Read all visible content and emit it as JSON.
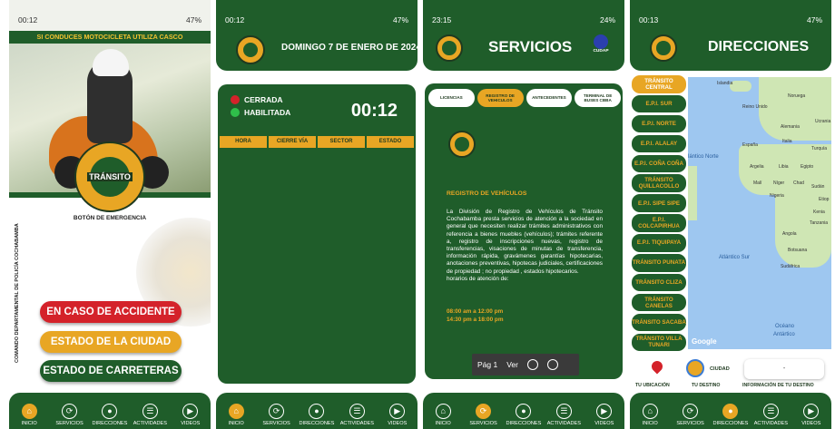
{
  "status": {
    "p1": {
      "time": "00:12",
      "battery": "47%"
    },
    "p2": {
      "time": "00:12",
      "battery": "47%"
    },
    "p3": {
      "time": "23:15",
      "battery": "24%"
    },
    "p4": {
      "time": "00:13",
      "battery": "47%"
    }
  },
  "nav": [
    "INICIO",
    "SERVICIOS",
    "DIRECCIONES",
    "ACTIVIDADES",
    "VIDEOS"
  ],
  "inicio": {
    "banner": "SI CONDUCES MOTOCICLETA UTILIZA CASCO",
    "logo_text": "TRÁNSITO",
    "emergency_label": "BOTÓN DE EMERGENCIA",
    "side_text": "COMANDO DEPARTAMENTAL DE POLICÍA COCHABAMBA",
    "buttons": [
      "EN CASO DE ACCIDENTE",
      "ESTADO DE LA CIUDAD",
      "ESTADO DE CARRETERAS"
    ]
  },
  "ciudad": {
    "date": "DOMINGO 7 DE ENERO DE 2024",
    "legend_closed": "CERRADA",
    "legend_open": "HABILITADA",
    "clock": "00:12",
    "columns": [
      "HORA",
      "CIERRE VÍA",
      "SECTOR",
      "ESTADO"
    ]
  },
  "servicios": {
    "title": "SERVICIOS",
    "cudap": "CUDAP",
    "tabs": [
      "LICENCIAS",
      "REGISTRO DE VEHICULOS",
      "ANTECEDENTES",
      "TERMINAL DE BUSES CBBA"
    ],
    "doc_title": "REGISTRO DE VEHÍCULOS",
    "doc_body": "La División de Registro de Vehículos de Tránsito Cochabamba presta servicios de atención a la sociedad en general que necesiten realizar trámites administrativos con referencia a bienes muebles (vehículos); trámites referente a, registro de inscripciones nuevas, registro de transferencias, visaciones de minutas de transferencia, información rápida, gravámenes garantías hipotecarias, anotaciones preventivas, hipotecas judiciales, certificaciones de propiedad ; no propiedad , estados hipotecarios.",
    "hours_label": "horarios de atención de:",
    "hours_1": "08:00 am a 12:00 pm",
    "hours_2": "14:30 pm a 18:00 pm",
    "pdf_page": "Pág 1",
    "pdf_view": "Ver"
  },
  "direcciones": {
    "title": "DIRECCIONES",
    "locations": [
      "TRÁNSITO CENTRAL",
      "E.P.I. SUR",
      "E.P.I. NORTE",
      "E.P.I. ALALAY",
      "E.P.I. COÑA COÑA",
      "TRÁNSITO QUILLACOLLO",
      "E.P.I. SIPE SIPE",
      "E.P.I. COLCAPIRHUA",
      "E.P.I. TIQUIPAYA",
      "TRÁNSITO PUNATA",
      "TRÁNSITO CLIZA",
      "TRÁNSITO CANELAS",
      "TRÁNSITO SACABA",
      "TRÁNSITO VILLA TUNARI"
    ],
    "map_labels": {
      "islandia": "Islandia",
      "noruega": "Noruega",
      "reino_unido": "Reino Unido",
      "alemania": "Alemania",
      "ucrania": "Ucrania",
      "espana": "España",
      "italia": "Italia",
      "turquia": "Turquía",
      "atlantico_norte": "lántico Norte",
      "argelia": "Argelia",
      "libia": "Libia",
      "egipto": "Egipto",
      "mali": "Malí",
      "niger": "Níger",
      "chad": "Chad",
      "sudan": "Sudán",
      "nigeria": "Nigeria",
      "etiopia": "Etiop",
      "kenia": "Kenia",
      "tanzania": "Tanzania",
      "angola": "Angola",
      "botsuana": "Botsuana",
      "sudafrica": "Sudáfrica",
      "atlantico_sur": "Atlántico Sur",
      "oceano": "Océano",
      "antartico": "Antártico",
      "google": "Google"
    },
    "ubicacion": "TU UBICACIÓN",
    "destino": "TU DESTINO",
    "ciudad": "CIUDAD",
    "info_value": "-",
    "info_label": "INFORMACIÓN DE TU DESTINO"
  },
  "colors": {
    "green": "#1f5d2a",
    "orange": "#e8a624",
    "red": "#d4222a"
  }
}
